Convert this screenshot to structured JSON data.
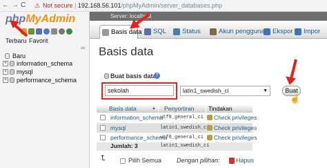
{
  "browser": {
    "not_secure": "Not secure",
    "url_host": "192.168.56.101",
    "url_path": "/phpMyAdmin/server_databases.php"
  },
  "sidebar": {
    "logo_php": "php",
    "logo_myadmin": "MyAdmin",
    "recent": "Terbaru",
    "favorites": "Favorit",
    "link_symbol": "∞",
    "new": "Baru",
    "databases": [
      "information_schema",
      "mysql",
      "performance_schema"
    ]
  },
  "server_strip": "Server: localhost",
  "tabs": [
    {
      "label": "Basis data",
      "icon": "database-icon"
    },
    {
      "label": "SQL",
      "icon": "sql-icon"
    },
    {
      "label": "Status",
      "icon": "status-icon"
    },
    {
      "label": "Akun pengguna",
      "icon": "users-icon"
    },
    {
      "label": "Ekspor",
      "icon": "export-icon"
    },
    {
      "label": "Impor",
      "icon": "import-icon"
    }
  ],
  "page_title": "Basis data",
  "create": {
    "label": "Buat basis data",
    "db_name_value": "sekolah",
    "collation_value": "latin1_swedish_ci",
    "button": "Buat"
  },
  "table": {
    "headers": [
      "Basis data",
      "Penyortiran",
      "Tindakan"
    ],
    "rows": [
      {
        "name": "information_schema",
        "collation": "utf8_general_ci",
        "action": "Check privileges"
      },
      {
        "name": "mysql",
        "collation": "latin1_swedish_ci",
        "action": "Check privileges"
      },
      {
        "name": "performance_schema",
        "collation": "utf8_general_ci",
        "action": "Check privileges"
      }
    ],
    "total_label": "Jumlah: 3",
    "total_collation": "latin1_swedish_ci"
  },
  "footer": {
    "select_all": "Pilih Semua",
    "with_selected": "Dengan pilihan:",
    "drop": "Hapus"
  }
}
